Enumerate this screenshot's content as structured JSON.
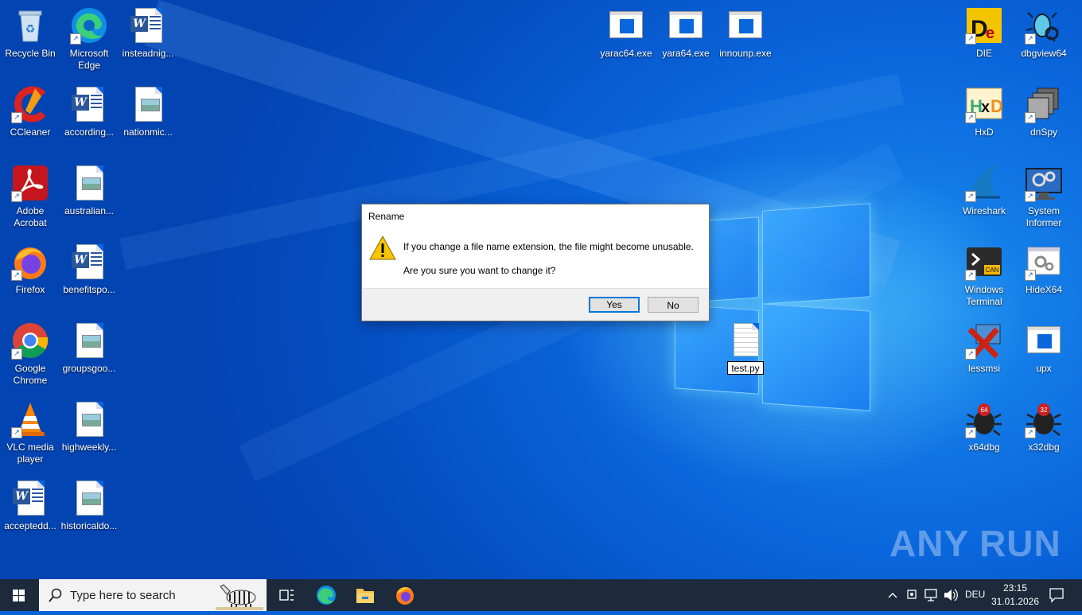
{
  "desktop_icons_left": [
    {
      "name": "Recycle Bin",
      "kind": "recycle"
    },
    {
      "name": "Microsoft Edge",
      "kind": "edge"
    },
    {
      "name": "insteadnig...",
      "kind": "word"
    },
    {
      "name": "CCleaner",
      "kind": "ccleaner"
    },
    {
      "name": "according...",
      "kind": "word"
    },
    {
      "name": "nationmic...",
      "kind": "image"
    },
    {
      "name": "Adobe Acrobat",
      "kind": "acrobat"
    },
    {
      "name": "australian...",
      "kind": "image"
    },
    {
      "name": "Firefox",
      "kind": "firefox"
    },
    {
      "name": "benefitspo...",
      "kind": "word"
    },
    {
      "name": "Google Chrome",
      "kind": "chrome"
    },
    {
      "name": "groupsgoo...",
      "kind": "image"
    },
    {
      "name": "VLC media player",
      "kind": "vlc"
    },
    {
      "name": "highweekly...",
      "kind": "image"
    },
    {
      "name": "acceptedd...",
      "kind": "word"
    },
    {
      "name": "historicaldo...",
      "kind": "image"
    }
  ],
  "desktop_icons_top": [
    {
      "name": "yarac64.exe"
    },
    {
      "name": "yara64.exe"
    },
    {
      "name": "innounp.exe"
    }
  ],
  "desktop_icons_right": [
    {
      "name": "DIE"
    },
    {
      "name": "dbgview64"
    },
    {
      "name": "HxD"
    },
    {
      "name": "dnSpy"
    },
    {
      "name": "Wireshark"
    },
    {
      "name": "System Informer"
    },
    {
      "name": "Windows Terminal"
    },
    {
      "name": "HideX64"
    },
    {
      "name": "lessmsi"
    },
    {
      "name": "upx"
    },
    {
      "name": "x64dbg"
    },
    {
      "name": "x32dbg"
    }
  ],
  "dialog": {
    "title": "Rename",
    "message_line1": "If you change a file name extension, the file might become unusable.",
    "message_line2": "Are you sure you want to change it?",
    "yes_label": "Yes",
    "no_label": "No"
  },
  "file_being_renamed": "test.py",
  "watermark": "ANY RUN",
  "taskbar": {
    "search_placeholder": "Type here to search",
    "language": "DEU",
    "time": "23:15",
    "date": "31.01.2026"
  },
  "colors": {
    "desktop": "#0a63d6",
    "taskbar": "#1c2a3b",
    "dialog_accent": "#0078d7",
    "warning": "#f7c600"
  }
}
